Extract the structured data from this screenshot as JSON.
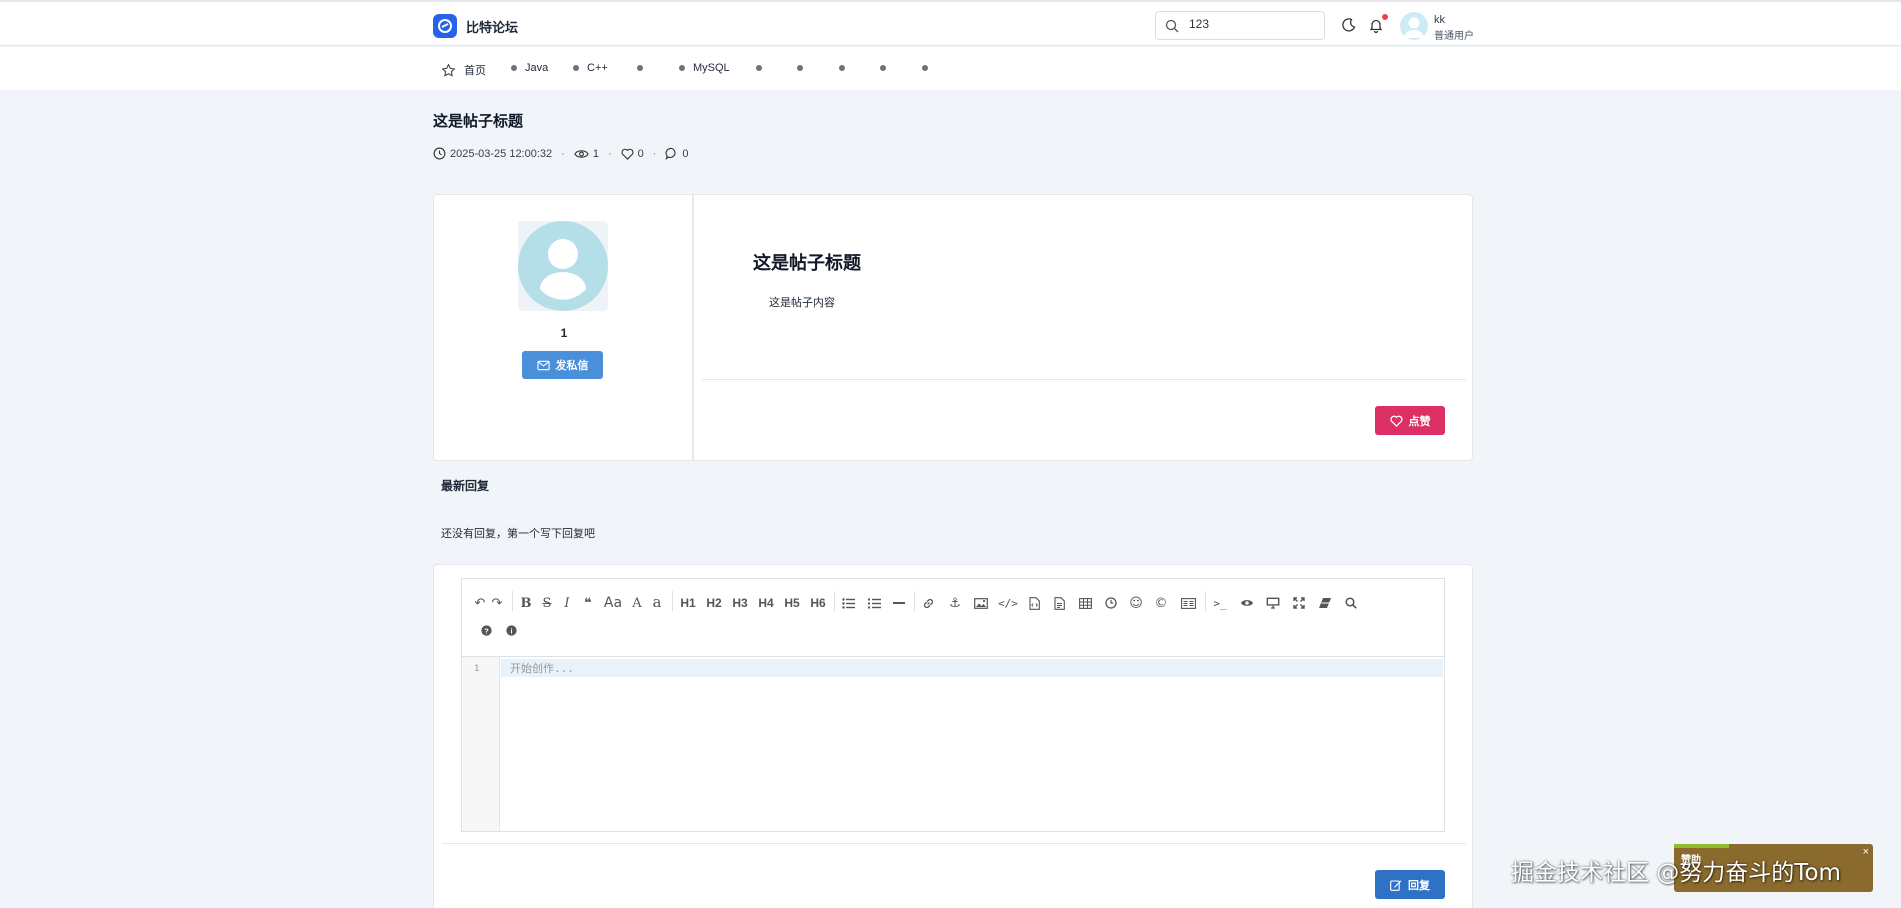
{
  "header": {
    "brand": "比特论坛",
    "search_value": "123",
    "user": {
      "name": "kk",
      "role": "普通用户"
    }
  },
  "nav": {
    "home": "首页",
    "items": [
      "Java",
      "C++",
      "",
      "MySQL",
      "",
      "",
      "",
      "",
      ""
    ]
  },
  "post": {
    "title": "这是帖子标题",
    "datetime": "2025-03-25 12:00:32",
    "views": "1",
    "likes": "0",
    "comments": "0",
    "author": "1",
    "message_button": "发私信",
    "content_title": "这是帖子标题",
    "content_body": "这是帖子内容",
    "like_button": "点赞"
  },
  "replies": {
    "title": "最新回复",
    "empty_text": "还没有回复，第一个写下回复吧"
  },
  "editor": {
    "headings": [
      "H1",
      "H2",
      "H3",
      "H4",
      "H5",
      "H6"
    ],
    "line_number": "1",
    "placeholder": "开始创作...",
    "submit_button": "回复"
  },
  "overlay": {
    "watermark": "掘金技术社区 @努力奋斗的Tom",
    "ad_label": "赞助",
    "ad_close": "×"
  },
  "colors": {
    "primary": "#2f71c4",
    "message_button": "#4a8fd9",
    "like_button": "#dc2f63",
    "notification_dot": "#ef4444",
    "page_background": "#f1f5f9"
  }
}
